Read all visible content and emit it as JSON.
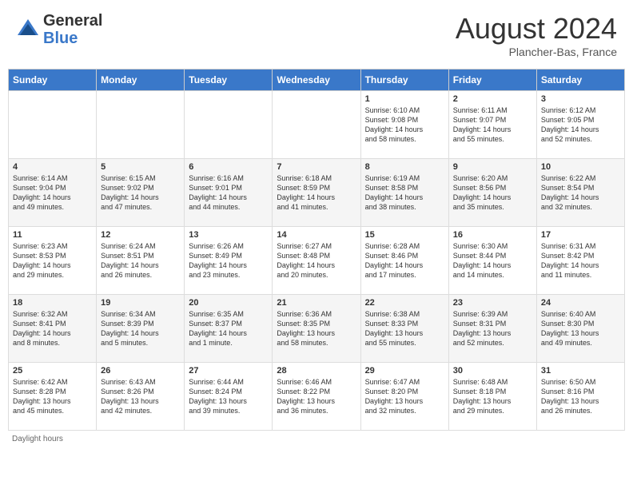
{
  "header": {
    "logo_general": "General",
    "logo_blue": "Blue",
    "month_title": "August 2024",
    "location": "Plancher-Bas, France"
  },
  "days_of_week": [
    "Sunday",
    "Monday",
    "Tuesday",
    "Wednesday",
    "Thursday",
    "Friday",
    "Saturday"
  ],
  "weeks": [
    [
      {
        "day": "",
        "info": ""
      },
      {
        "day": "",
        "info": ""
      },
      {
        "day": "",
        "info": ""
      },
      {
        "day": "",
        "info": ""
      },
      {
        "day": "1",
        "info": "Sunrise: 6:10 AM\nSunset: 9:08 PM\nDaylight: 14 hours\nand 58 minutes."
      },
      {
        "day": "2",
        "info": "Sunrise: 6:11 AM\nSunset: 9:07 PM\nDaylight: 14 hours\nand 55 minutes."
      },
      {
        "day": "3",
        "info": "Sunrise: 6:12 AM\nSunset: 9:05 PM\nDaylight: 14 hours\nand 52 minutes."
      }
    ],
    [
      {
        "day": "4",
        "info": "Sunrise: 6:14 AM\nSunset: 9:04 PM\nDaylight: 14 hours\nand 49 minutes."
      },
      {
        "day": "5",
        "info": "Sunrise: 6:15 AM\nSunset: 9:02 PM\nDaylight: 14 hours\nand 47 minutes."
      },
      {
        "day": "6",
        "info": "Sunrise: 6:16 AM\nSunset: 9:01 PM\nDaylight: 14 hours\nand 44 minutes."
      },
      {
        "day": "7",
        "info": "Sunrise: 6:18 AM\nSunset: 8:59 PM\nDaylight: 14 hours\nand 41 minutes."
      },
      {
        "day": "8",
        "info": "Sunrise: 6:19 AM\nSunset: 8:58 PM\nDaylight: 14 hours\nand 38 minutes."
      },
      {
        "day": "9",
        "info": "Sunrise: 6:20 AM\nSunset: 8:56 PM\nDaylight: 14 hours\nand 35 minutes."
      },
      {
        "day": "10",
        "info": "Sunrise: 6:22 AM\nSunset: 8:54 PM\nDaylight: 14 hours\nand 32 minutes."
      }
    ],
    [
      {
        "day": "11",
        "info": "Sunrise: 6:23 AM\nSunset: 8:53 PM\nDaylight: 14 hours\nand 29 minutes."
      },
      {
        "day": "12",
        "info": "Sunrise: 6:24 AM\nSunset: 8:51 PM\nDaylight: 14 hours\nand 26 minutes."
      },
      {
        "day": "13",
        "info": "Sunrise: 6:26 AM\nSunset: 8:49 PM\nDaylight: 14 hours\nand 23 minutes."
      },
      {
        "day": "14",
        "info": "Sunrise: 6:27 AM\nSunset: 8:48 PM\nDaylight: 14 hours\nand 20 minutes."
      },
      {
        "day": "15",
        "info": "Sunrise: 6:28 AM\nSunset: 8:46 PM\nDaylight: 14 hours\nand 17 minutes."
      },
      {
        "day": "16",
        "info": "Sunrise: 6:30 AM\nSunset: 8:44 PM\nDaylight: 14 hours\nand 14 minutes."
      },
      {
        "day": "17",
        "info": "Sunrise: 6:31 AM\nSunset: 8:42 PM\nDaylight: 14 hours\nand 11 minutes."
      }
    ],
    [
      {
        "day": "18",
        "info": "Sunrise: 6:32 AM\nSunset: 8:41 PM\nDaylight: 14 hours\nand 8 minutes."
      },
      {
        "day": "19",
        "info": "Sunrise: 6:34 AM\nSunset: 8:39 PM\nDaylight: 14 hours\nand 5 minutes."
      },
      {
        "day": "20",
        "info": "Sunrise: 6:35 AM\nSunset: 8:37 PM\nDaylight: 14 hours\nand 1 minute."
      },
      {
        "day": "21",
        "info": "Sunrise: 6:36 AM\nSunset: 8:35 PM\nDaylight: 13 hours\nand 58 minutes."
      },
      {
        "day": "22",
        "info": "Sunrise: 6:38 AM\nSunset: 8:33 PM\nDaylight: 13 hours\nand 55 minutes."
      },
      {
        "day": "23",
        "info": "Sunrise: 6:39 AM\nSunset: 8:31 PM\nDaylight: 13 hours\nand 52 minutes."
      },
      {
        "day": "24",
        "info": "Sunrise: 6:40 AM\nSunset: 8:30 PM\nDaylight: 13 hours\nand 49 minutes."
      }
    ],
    [
      {
        "day": "25",
        "info": "Sunrise: 6:42 AM\nSunset: 8:28 PM\nDaylight: 13 hours\nand 45 minutes."
      },
      {
        "day": "26",
        "info": "Sunrise: 6:43 AM\nSunset: 8:26 PM\nDaylight: 13 hours\nand 42 minutes."
      },
      {
        "day": "27",
        "info": "Sunrise: 6:44 AM\nSunset: 8:24 PM\nDaylight: 13 hours\nand 39 minutes."
      },
      {
        "day": "28",
        "info": "Sunrise: 6:46 AM\nSunset: 8:22 PM\nDaylight: 13 hours\nand 36 minutes."
      },
      {
        "day": "29",
        "info": "Sunrise: 6:47 AM\nSunset: 8:20 PM\nDaylight: 13 hours\nand 32 minutes."
      },
      {
        "day": "30",
        "info": "Sunrise: 6:48 AM\nSunset: 8:18 PM\nDaylight: 13 hours\nand 29 minutes."
      },
      {
        "day": "31",
        "info": "Sunrise: 6:50 AM\nSunset: 8:16 PM\nDaylight: 13 hours\nand 26 minutes."
      }
    ]
  ],
  "footer": {
    "note": "Daylight hours"
  }
}
